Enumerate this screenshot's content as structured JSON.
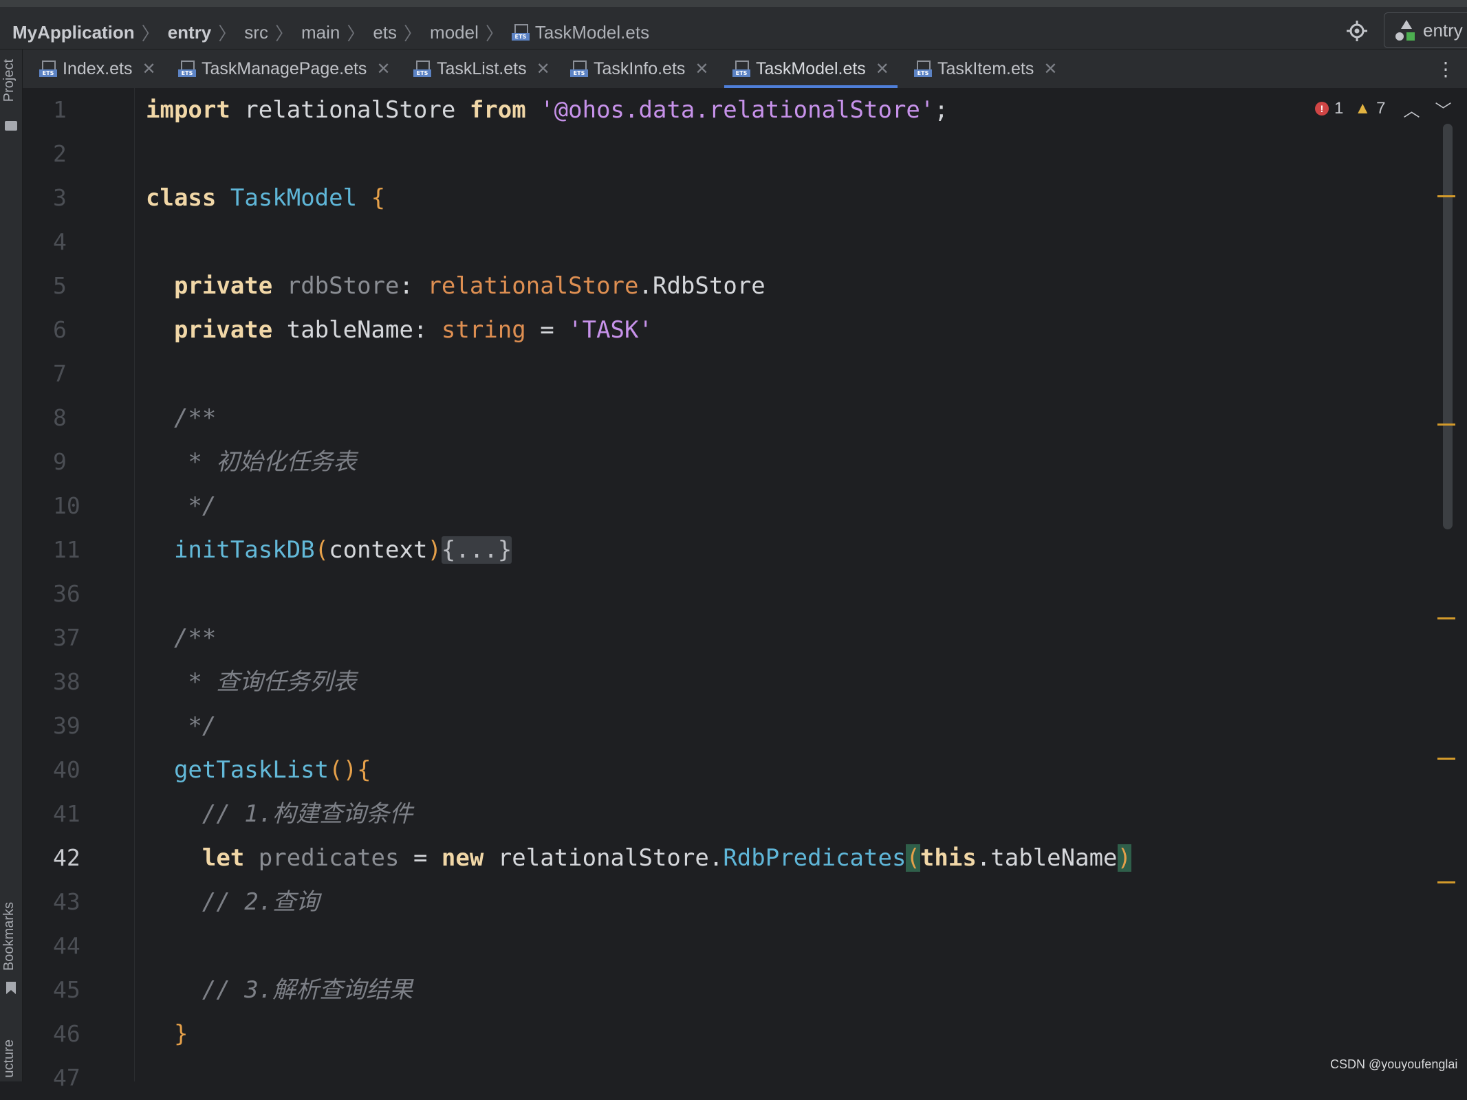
{
  "breadcrumb": {
    "items": [
      "MyApplication",
      "entry",
      "src",
      "main",
      "ets",
      "model",
      "TaskModel.ets"
    ]
  },
  "run_config": {
    "label": "entry"
  },
  "left_tools": {
    "project": "Project",
    "bookmarks": "Bookmarks",
    "structure": "ucture"
  },
  "tabs": [
    {
      "label": "Index.ets"
    },
    {
      "label": "TaskManagePage.ets"
    },
    {
      "label": "TaskList.ets"
    },
    {
      "label": "TaskInfo.ets"
    },
    {
      "label": "TaskModel.ets",
      "active": true
    },
    {
      "label": "TaskItem.ets"
    }
  ],
  "inspections": {
    "errors": "1",
    "warnings": "7"
  },
  "line_numbers": [
    "1",
    "2",
    "3",
    "4",
    "5",
    "6",
    "7",
    "8",
    "9",
    "10",
    "11",
    "36",
    "37",
    "38",
    "39",
    "40",
    "41",
    "42",
    "43",
    "44",
    "45",
    "46",
    "47"
  ],
  "code": {
    "l1": {
      "kw_import": "import",
      "ident": " relationalStore ",
      "kw_from": "from",
      "sp": " ",
      "str": "'@ohos.data.relationalStore'",
      "semi": ";"
    },
    "l3": {
      "kw": "class",
      "sp": " ",
      "name": "TaskModel",
      "sp2": " ",
      "brace": "{"
    },
    "l5": {
      "indent": "  ",
      "kw": "private",
      "sp": " ",
      "field": "rdbStore",
      "colon": ": ",
      "ns": "relationalStore",
      "dot": ".",
      "type": "RdbStore"
    },
    "l6": {
      "indent": "  ",
      "kw": "private",
      "rest": " tableName: ",
      "type": "string",
      "eq": " = ",
      "str": "'TASK'"
    },
    "l8": "  /**",
    "l9": "   * 初始化任务表",
    "l10": "   */",
    "l11": {
      "indent": "  ",
      "fn": "initTaskDB",
      "p1": "(",
      "arg": "context",
      "p2": ")",
      "folded": "{...}"
    },
    "l37": "  /**",
    "l38": "   * 查询任务列表",
    "l39": "   */",
    "l40": {
      "indent": "  ",
      "fn": "getTaskList",
      "parens": "()",
      "brace": "{"
    },
    "l41": "    // 1.构建查询条件",
    "l42": {
      "indent": "    ",
      "kw_let": "let",
      "var": " predicates",
      "eq": " = ",
      "kw_new": "new",
      "ns": " relationalStore.",
      "cls": "RdbPredicates",
      "p1": "(",
      "kw_this": "this",
      "rest": ".tableName",
      "p2": ")"
    },
    "l43": "    // 2.查询",
    "l45": "    // 3.解析查询结果",
    "l46": {
      "indent": "  ",
      "brace": "}"
    }
  },
  "watermark": "CSDN @youyoufenglai",
  "colors": {
    "accent": "#4f7fd9",
    "keyword": "#f1d7a7",
    "string": "#9ecf6b",
    "class": "#5fb6d8",
    "type": "#de8f52",
    "comment": "#7d8087"
  }
}
